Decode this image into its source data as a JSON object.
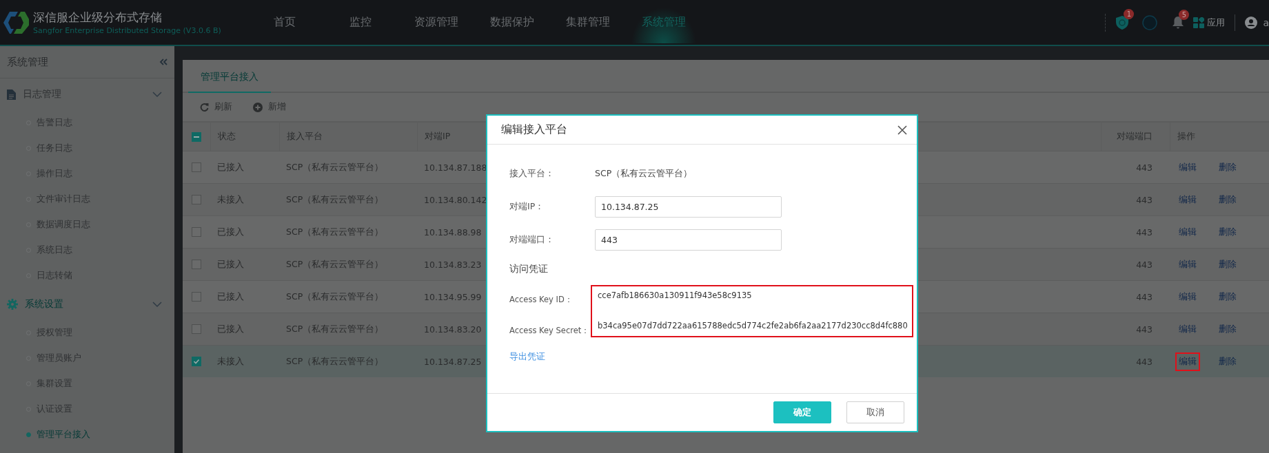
{
  "app": {
    "title": "深信服企业级分布式存储",
    "subtitle": "Sangfor Enterprise Distributed Storage  (V3.0.6 B)"
  },
  "nav": [
    {
      "label": "首页",
      "selected": false
    },
    {
      "label": "监控",
      "selected": false
    },
    {
      "label": "资源管理",
      "selected": false
    },
    {
      "label": "数据保护",
      "selected": false
    },
    {
      "label": "集群管理",
      "selected": false
    },
    {
      "label": "系统管理",
      "selected": true
    }
  ],
  "header_actions": {
    "security_badge": "1",
    "notifications_badge": "5",
    "apps_label": "应用",
    "user": "a"
  },
  "sidebar": {
    "title": "系统管理",
    "groups": [
      {
        "label": "日志管理",
        "kind": "document",
        "expanded": true,
        "active": false,
        "items": [
          {
            "label": "告警日志",
            "selected": false
          },
          {
            "label": "任务日志",
            "selected": false
          },
          {
            "label": "操作日志",
            "selected": false
          },
          {
            "label": "文件审计日志",
            "selected": false
          },
          {
            "label": "数据调度日志",
            "selected": false
          },
          {
            "label": "系统日志",
            "selected": false
          },
          {
            "label": "日志转储",
            "selected": false
          }
        ]
      },
      {
        "label": "系统设置",
        "kind": "settings",
        "expanded": true,
        "active": true,
        "items": [
          {
            "label": "授权管理",
            "selected": false
          },
          {
            "label": "管理员账户",
            "selected": false
          },
          {
            "label": "集群设置",
            "selected": false
          },
          {
            "label": "认证设置",
            "selected": false
          },
          {
            "label": "管理平台接入",
            "selected": true
          }
        ]
      }
    ]
  },
  "tabs": [
    {
      "label": "管理平台接入",
      "selected": true
    }
  ],
  "toolbar": [
    {
      "label": "刷新",
      "kind": "refresh"
    },
    {
      "label": "新增",
      "kind": "add"
    }
  ],
  "table": {
    "select_all_partial": true,
    "columns": [
      "状态",
      "接入平台",
      "对端IP",
      "对端端口",
      "操作"
    ],
    "rows": [
      {
        "checked": false,
        "status": "已接入",
        "platform": "SCP（私有云云管平台）",
        "ip": "10.134.87.188",
        "port": "443",
        "actions": [
          {
            "label": "编辑",
            "highlighted": false
          },
          {
            "label": "删除",
            "highlighted": false
          }
        ]
      },
      {
        "checked": false,
        "status": "未接入",
        "platform": "SCP（私有云云管平台）",
        "ip": "10.134.80.142",
        "port": "443",
        "actions": [
          {
            "label": "编辑",
            "highlighted": false
          },
          {
            "label": "删除",
            "highlighted": false
          }
        ]
      },
      {
        "checked": false,
        "status": "已接入",
        "platform": "SCP（私有云云管平台）",
        "ip": "10.134.88.98",
        "port": "443",
        "actions": [
          {
            "label": "编辑",
            "highlighted": false
          },
          {
            "label": "删除",
            "highlighted": false
          }
        ]
      },
      {
        "checked": false,
        "status": "已接入",
        "platform": "SCP（私有云云管平台）",
        "ip": "10.134.83.23",
        "port": "443",
        "actions": [
          {
            "label": "编辑",
            "highlighted": false
          },
          {
            "label": "删除",
            "highlighted": false
          }
        ]
      },
      {
        "checked": false,
        "status": "已接入",
        "platform": "SCP（私有云云管平台）",
        "ip": "10.134.95.99",
        "port": "443",
        "actions": [
          {
            "label": "编辑",
            "highlighted": false
          },
          {
            "label": "删除",
            "highlighted": false
          }
        ]
      },
      {
        "checked": false,
        "status": "已接入",
        "platform": "SCP（私有云云管平台）",
        "ip": "10.134.83.20",
        "port": "443",
        "actions": [
          {
            "label": "编辑",
            "highlighted": false
          },
          {
            "label": "删除",
            "highlighted": false
          }
        ]
      },
      {
        "checked": true,
        "status": "未接入",
        "platform": "SCP（私有云云管平台）",
        "ip": "10.134.87.25",
        "port": "443",
        "actions": [
          {
            "label": "编辑",
            "highlighted": true
          },
          {
            "label": "删除",
            "highlighted": false
          }
        ]
      }
    ]
  },
  "dialog": {
    "title": "编辑接入平台",
    "fields": [
      {
        "kind": "text",
        "label": "接入平台：",
        "value": "SCP（私有云云管平台）"
      },
      {
        "kind": "input",
        "label": "对端IP：",
        "value": "10.134.87.25"
      },
      {
        "kind": "input",
        "label": "对端端口：",
        "value": "443"
      }
    ],
    "section": "访问凭证",
    "credentials": {
      "highlighted": true,
      "rows": [
        {
          "label": "Access Key ID：",
          "value": "cce7afb186630a130911f943e58c9135"
        },
        {
          "label": "Access Key Secret：",
          "value": "b34ca95e07d7dd722aa615788edc5d774c2fe2ab6fa2aa2177d230cc8d4fc880"
        }
      ]
    },
    "link": "导出凭证",
    "buttons": [
      {
        "label": "确定",
        "kind": "primary"
      },
      {
        "label": "取消",
        "kind": "default"
      }
    ]
  }
}
